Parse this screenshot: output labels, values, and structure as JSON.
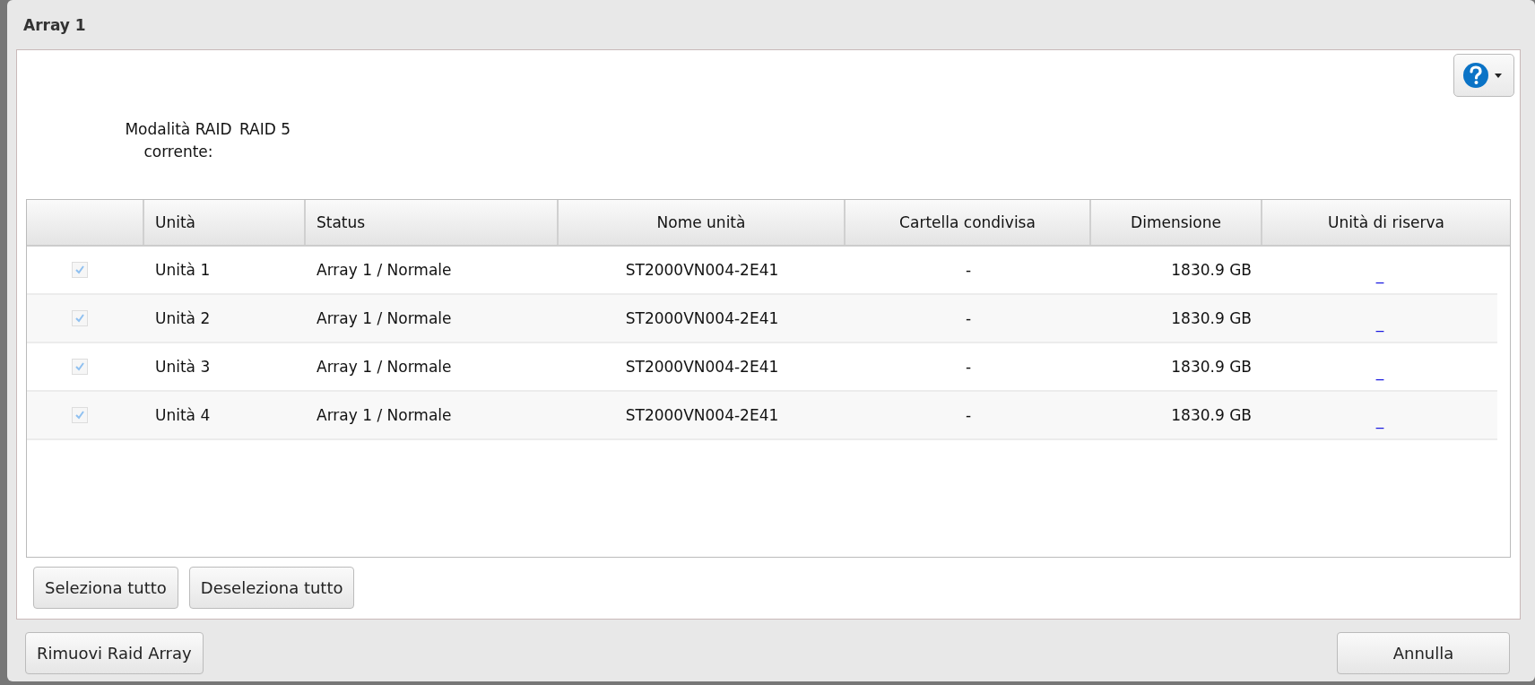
{
  "window": {
    "title": "Array 1"
  },
  "raid_mode": {
    "label": "Modalità RAID corrente:",
    "value": "RAID 5"
  },
  "table": {
    "columns": [
      "Unità",
      "Status",
      "Nome unità",
      "Cartella condivisa",
      "Dimensione",
      "Unità di riserva"
    ],
    "rows": [
      {
        "checked": true,
        "disabled": true,
        "unit": "Unità 1",
        "status": "Array 1 / Normale",
        "name": "ST2000VN004-2E41",
        "shared_folder": "-",
        "size": "1830.9 GB",
        "spare": "_"
      },
      {
        "checked": true,
        "disabled": true,
        "unit": "Unità 2",
        "status": "Array 1 / Normale",
        "name": "ST2000VN004-2E41",
        "shared_folder": "-",
        "size": "1830.9 GB",
        "spare": "_"
      },
      {
        "checked": true,
        "disabled": true,
        "unit": "Unità 3",
        "status": "Array 1 / Normale",
        "name": "ST2000VN004-2E41",
        "shared_folder": "-",
        "size": "1830.9 GB",
        "spare": "_"
      },
      {
        "checked": true,
        "disabled": true,
        "unit": "Unità 4",
        "status": "Array 1 / Normale",
        "name": "ST2000VN004-2E41",
        "shared_folder": "-",
        "size": "1830.9 GB",
        "spare": "_"
      }
    ]
  },
  "selection_buttons": [
    "Seleziona tutto",
    "Deseleziona tutto"
  ],
  "footer": {
    "remove_button": "Rimuovi Raid Array",
    "cancel_button": "Annulla"
  }
}
